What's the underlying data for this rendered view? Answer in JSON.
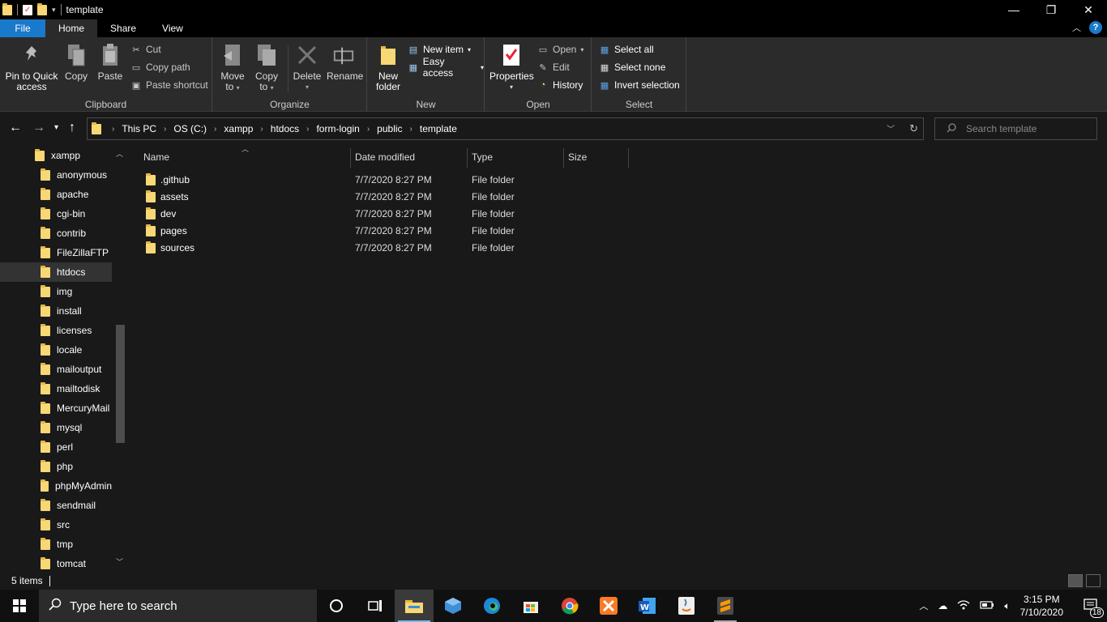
{
  "window": {
    "title": "template",
    "minimize": "—",
    "restore": "❐",
    "close": "✕"
  },
  "ribbon_tabs": [
    "File",
    "Home",
    "Share",
    "View"
  ],
  "help": "?",
  "ribbon": {
    "clipboard": {
      "label": "Clipboard",
      "pin": "Pin to Quick access",
      "pin_l1": "Pin to Quick",
      "pin_l2": "access",
      "copy": "Copy",
      "paste": "Paste",
      "cut": "Cut",
      "copy_path": "Copy path",
      "paste_shortcut": "Paste shortcut"
    },
    "organize": {
      "label": "Organize",
      "move_l1": "Move",
      "move_l2": "to",
      "copy_l1": "Copy",
      "copy_l2": "to",
      "delete": "Delete",
      "rename": "Rename"
    },
    "new": {
      "label": "New",
      "new_folder_l1": "New",
      "new_folder_l2": "folder",
      "new_item": "New item",
      "easy_access": "Easy access"
    },
    "open": {
      "label": "Open",
      "properties": "Properties",
      "open": "Open",
      "edit": "Edit",
      "history": "History"
    },
    "select": {
      "label": "Select",
      "select_all": "Select all",
      "select_none": "Select none",
      "invert": "Invert selection"
    }
  },
  "address": {
    "crumbs": [
      "This PC",
      "OS (C:)",
      "xampp",
      "htdocs",
      "form-login",
      "public",
      "template"
    ]
  },
  "search": {
    "placeholder": "Search template"
  },
  "nav_tree": {
    "root": "xampp",
    "items": [
      "anonymous",
      "apache",
      "cgi-bin",
      "contrib",
      "FileZillaFTP",
      "htdocs",
      "img",
      "install",
      "licenses",
      "locale",
      "mailoutput",
      "mailtodisk",
      "MercuryMail",
      "mysql",
      "perl",
      "php",
      "phpMyAdmin",
      "sendmail",
      "src",
      "tmp",
      "tomcat"
    ],
    "selected": "htdocs"
  },
  "columns": {
    "name": "Name",
    "date": "Date modified",
    "type": "Type",
    "size": "Size"
  },
  "files": [
    {
      "name": ".github",
      "date": "7/7/2020 8:27 PM",
      "type": "File folder"
    },
    {
      "name": "assets",
      "date": "7/7/2020 8:27 PM",
      "type": "File folder"
    },
    {
      "name": "dev",
      "date": "7/7/2020 8:27 PM",
      "type": "File folder"
    },
    {
      "name": "pages",
      "date": "7/7/2020 8:27 PM",
      "type": "File folder"
    },
    {
      "name": "sources",
      "date": "7/7/2020 8:27 PM",
      "type": "File folder"
    }
  ],
  "status": {
    "count": "5 items"
  },
  "taskbar": {
    "search_placeholder": "Type here to search",
    "time": "3:15 PM",
    "date": "7/10/2020",
    "notifications": "18"
  },
  "colors": {
    "file_tab": "#1979ca",
    "folder": "#f8d775",
    "background": "#191919"
  }
}
